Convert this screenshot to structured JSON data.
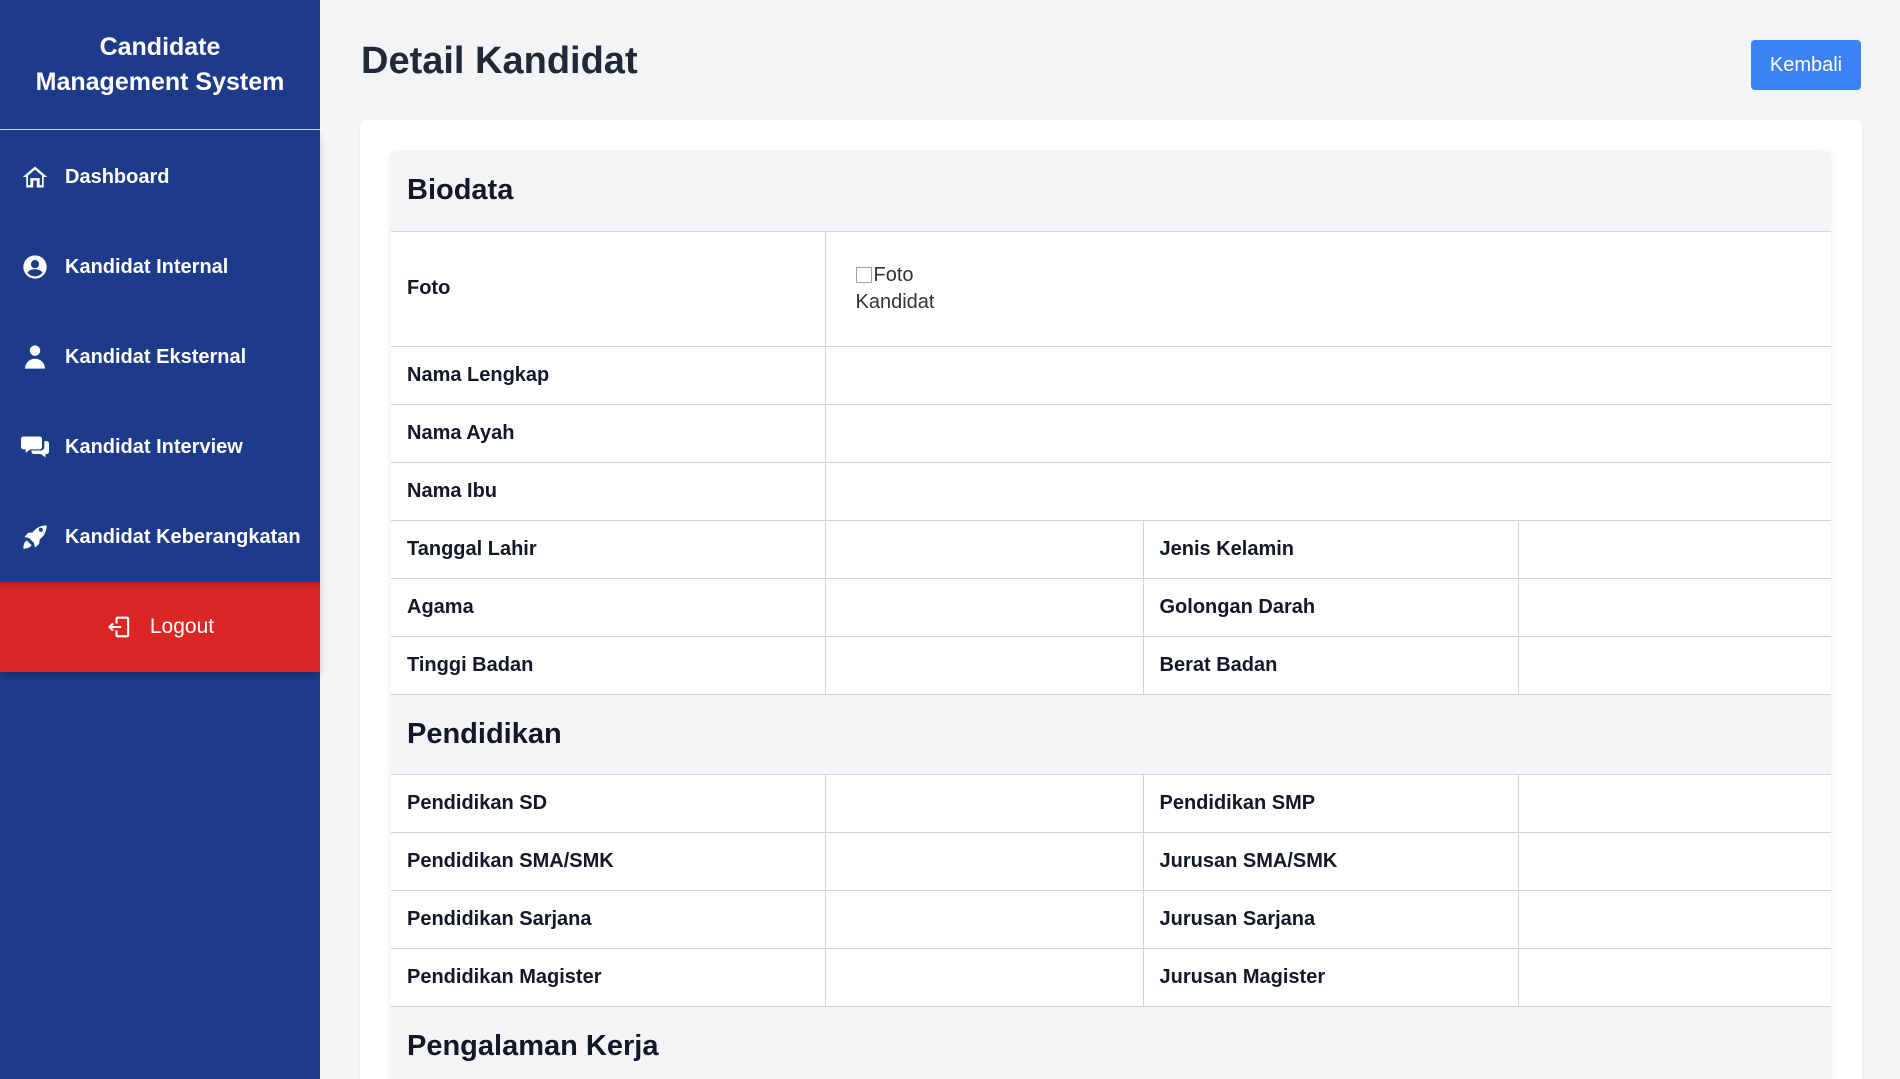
{
  "app": {
    "title": "Candidate Management System"
  },
  "sidebar": {
    "items": [
      {
        "label": "Dashboard",
        "icon": "home-icon"
      },
      {
        "label": "Kandidat Internal",
        "icon": "user-circle-icon"
      },
      {
        "label": "Kandidat Eksternal",
        "icon": "user-icon"
      },
      {
        "label": "Kandidat Interview",
        "icon": "comments-icon"
      },
      {
        "label": "Kandidat Keberangkatan",
        "icon": "rocket-icon"
      }
    ],
    "logout": {
      "label": "Logout",
      "icon": "logout-icon"
    }
  },
  "header": {
    "title": "Detail Kandidat",
    "back_label": "Kembali"
  },
  "sections": {
    "biodata": {
      "title": "Biodata",
      "foto_label": "Foto",
      "foto_alt": "Foto Kandidat",
      "nama_lengkap": {
        "label": "Nama Lengkap",
        "value": ""
      },
      "nama_ayah": {
        "label": "Nama Ayah",
        "value": ""
      },
      "nama_ibu": {
        "label": "Nama Ibu",
        "value": ""
      },
      "tanggal_lahir": {
        "label": "Tanggal Lahir",
        "value": ""
      },
      "jenis_kelamin": {
        "label": "Jenis Kelamin",
        "value": ""
      },
      "agama": {
        "label": "Agama",
        "value": ""
      },
      "golongan_darah": {
        "label": "Golongan Darah",
        "value": ""
      },
      "tinggi_badan": {
        "label": "Tinggi Badan",
        "value": ""
      },
      "berat_badan": {
        "label": "Berat Badan",
        "value": ""
      }
    },
    "pendidikan": {
      "title": "Pendidikan",
      "sd": {
        "label": "Pendidikan SD",
        "value": ""
      },
      "smp": {
        "label": "Pendidikan SMP",
        "value": ""
      },
      "sma": {
        "label": "Pendidikan SMA/SMK",
        "value": ""
      },
      "jurusan_sma": {
        "label": "Jurusan SMA/SMK",
        "value": ""
      },
      "sarjana": {
        "label": "Pendidikan Sarjana",
        "value": ""
      },
      "jurusan_sarjana": {
        "label": "Jurusan Sarjana",
        "value": ""
      },
      "magister": {
        "label": "Pendidikan Magister",
        "value": ""
      },
      "jurusan_magister": {
        "label": "Jurusan Magister",
        "value": ""
      }
    },
    "pengalaman": {
      "title": "Pengalaman Kerja"
    }
  },
  "colors": {
    "sidebar": "#1e3a8a",
    "logout": "#dc2626",
    "accent": "#3b82f6",
    "background": "#f3f4f6"
  }
}
